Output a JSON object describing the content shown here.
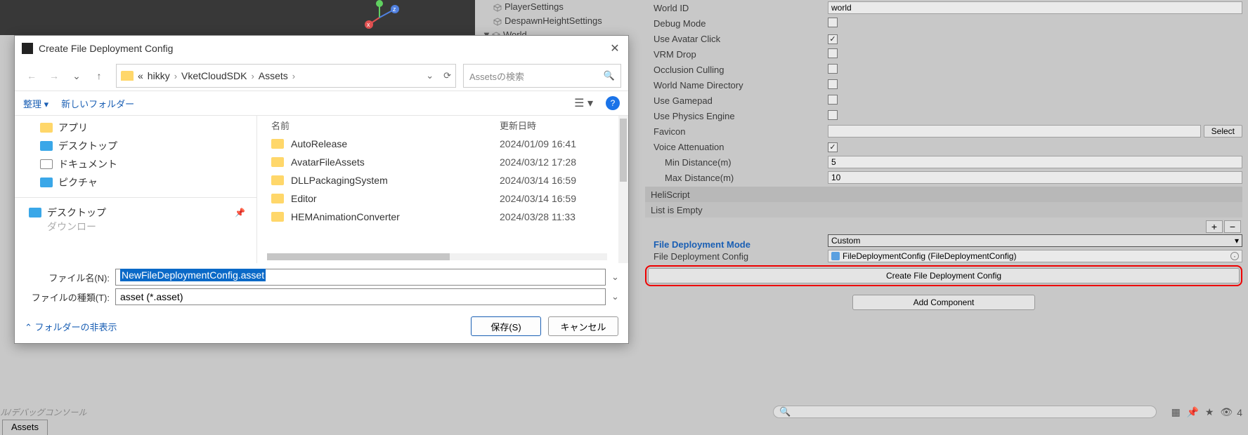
{
  "hierarchy": {
    "items": [
      "PlayerSettings",
      "DespawnHeightSettings",
      "World"
    ]
  },
  "inspector": {
    "world_id_label": "World ID",
    "world_id_value": "world",
    "debug_mode_label": "Debug Mode",
    "use_avatar_click_label": "Use Avatar Click",
    "vrm_drop_label": "VRM Drop",
    "occlusion_label": "Occlusion Culling",
    "world_name_dir_label": "World Name Directory",
    "use_gamepad_label": "Use Gamepad",
    "use_physics_label": "Use Physics Engine",
    "favicon_label": "Favicon",
    "select_btn": "Select",
    "voice_atten_label": "Voice Attenuation",
    "min_dist_label": "Min Distance(m)",
    "min_dist_value": "5",
    "max_dist_label": "Max Distance(m)",
    "max_dist_value": "10",
    "heliscript_header": "HeliScript",
    "list_empty": "List is Empty",
    "mode_header": "File Deployment Mode",
    "mode_value": "Custom",
    "config_label": "File Deployment Config",
    "config_ref": "FileDeploymentConfig (FileDeploymentConfig)",
    "create_btn": "Create File Deployment Config",
    "add_component": "Add Component"
  },
  "dialog": {
    "title": "Create File Deployment Config",
    "crumbs": [
      "hikky",
      "VketCloudSDK",
      "Assets"
    ],
    "crumb_prefix": "«",
    "search_placeholder": "Assetsの検索",
    "organize": "整理",
    "new_folder": "新しいフォルダー",
    "quick": {
      "apps": "アプリ",
      "desktop": "デスクトップ",
      "documents": "ドキュメント",
      "pictures": "ピクチャ"
    },
    "tree_desktop": "デスクトップ",
    "tree_downloads_partial": "ダウンロー",
    "col_name": "名前",
    "col_date": "更新日時",
    "files": [
      {
        "name": "AutoRelease",
        "date": "2024/01/09 16:41"
      },
      {
        "name": "AvatarFileAssets",
        "date": "2024/03/12 17:28"
      },
      {
        "name": "DLLPackagingSystem",
        "date": "2024/03/14 16:59"
      },
      {
        "name": "Editor",
        "date": "2024/03/14 16:59"
      },
      {
        "name": "HEMAnimationConverter",
        "date": "2024/03/28 11:33"
      }
    ],
    "filename_label": "ファイル名(N):",
    "filename_value": "NewFileDeploymentConfig.asset",
    "filetype_label": "ファイルの種類(T):",
    "filetype_value": "asset (*.asset)",
    "hide_folders": "フォルダーの非表示",
    "save_btn": "保存(S)",
    "cancel_btn": "キャンセル"
  },
  "bottom": {
    "console_text": "ル/デバッグコンソール",
    "assets_tab": "Assets",
    "eye_count": "4"
  }
}
